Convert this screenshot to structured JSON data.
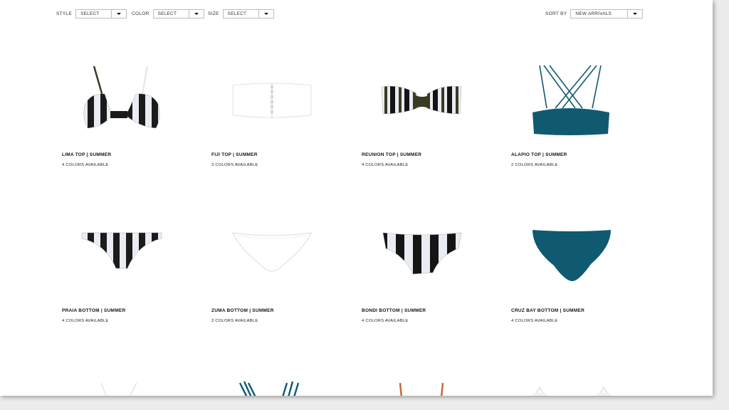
{
  "filters": {
    "style": {
      "label": "STYLE",
      "value": "SELECT"
    },
    "color": {
      "label": "COLOR",
      "value": "SELECT"
    },
    "size": {
      "label": "SIZE",
      "value": "SELECT"
    },
    "sort": {
      "label": "SORT BY",
      "value": "NEW ARRIVALS"
    }
  },
  "products": [
    {
      "name": "LIMA TOP | SUMMER",
      "colors": "4 COLORS AVAILABLE",
      "image": "striped-underwire-top"
    },
    {
      "name": "FIJI TOP | SUMMER",
      "colors": "3 COLORS AVAILABLE",
      "image": "white-bandeau-top"
    },
    {
      "name": "REUNION TOP | SUMMER",
      "colors": "4 COLORS AVAILABLE",
      "image": "striped-bandeau-top"
    },
    {
      "name": "ALAPIO TOP | SUMMER",
      "colors": "2 COLORS AVAILABLE",
      "image": "teal-strappy-top"
    },
    {
      "name": "PRAIA BOTTOM | SUMMER",
      "colors": "4 COLORS AVAILABLE",
      "image": "striped-bottom"
    },
    {
      "name": "ZUMA BOTTOM | SUMMER",
      "colors": "3 COLORS AVAILABLE",
      "image": "white-bottom"
    },
    {
      "name": "BONDI BOTTOM | SUMMER",
      "colors": "4 COLORS AVAILABLE",
      "image": "striped-hipster-bottom"
    },
    {
      "name": "CRUZ BAY BOTTOM | SUMMER",
      "colors": "4 COLORS AVAILABLE",
      "image": "teal-bottom"
    }
  ],
  "colors": {
    "teal": "#0f5a70",
    "olive": "#3b3a22",
    "stripe_light": "#e9ecf2",
    "rust": "#c8693a",
    "border": "#bdbdbd"
  }
}
